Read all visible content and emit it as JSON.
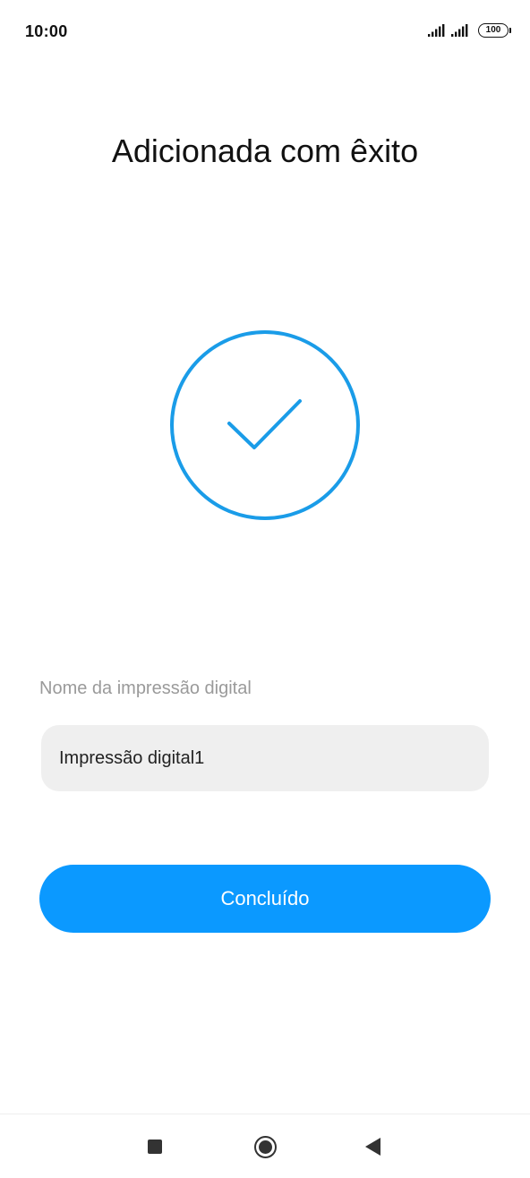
{
  "status_bar": {
    "time": "10:00",
    "battery": "100",
    "icons": [
      "signal-icon",
      "signal-icon",
      "battery-icon"
    ]
  },
  "screen": {
    "title": "Adicionada com êxito",
    "success_icon": "check-circle-icon"
  },
  "form": {
    "name_label": "Nome da impressão digital",
    "name_value": "Impressão digital1"
  },
  "actions": {
    "done_label": "Concluído"
  },
  "nav_bar": {
    "icons": [
      "recents-square-icon",
      "home-circle-icon",
      "back-triangle-icon"
    ]
  },
  "colors": {
    "accent": "#0b99ff",
    "ring": "#1a9ce8",
    "input_bg": "#efefef",
    "label_text": "#9a9a9a"
  }
}
